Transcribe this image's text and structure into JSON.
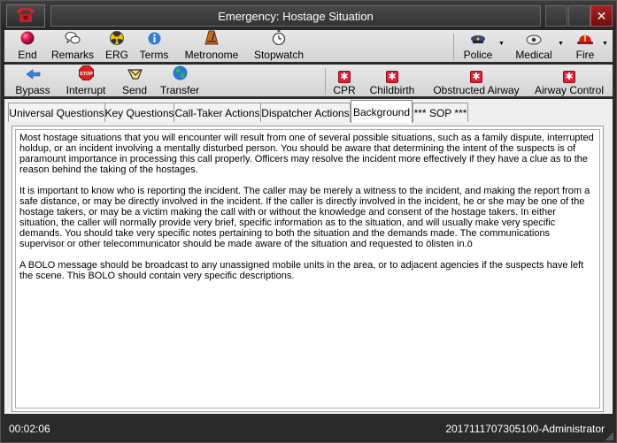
{
  "window": {
    "title": "Emergency: Hostage Situation"
  },
  "toolbar1": {
    "end": "End",
    "remarks": "Remarks",
    "erg": "ERG",
    "terms": "Terms",
    "metronome": "Metronome",
    "stopwatch": "Stopwatch",
    "police": "Police",
    "medical": "Medical",
    "fire": "Fire"
  },
  "toolbar2": {
    "bypass": "Bypass",
    "interrupt": "Interrupt",
    "send": "Send",
    "transfer": "Transfer",
    "cpr": "CPR",
    "childbirth": "Childbirth",
    "obstructed_airway": "Obstructed Airway",
    "airway_control": "Airway Control",
    "stop_sign_text": "STOP"
  },
  "tabs": [
    "Universal Questions",
    "Key Questions",
    "Call-Taker Actions",
    "Dispatcher Actions",
    "Background",
    "*** SOP ***"
  ],
  "active_tab": "Background",
  "content": {
    "paragraphs": [
      "Most hostage situations that you will encounter will result from one of several possible situations, such as a family dispute, interrupted holdup, or an incident involving a mentally disturbed person.  You should be aware that determining the intent of the suspects is of paramount importance in processing this call properly.  Officers may resolve the incident more effectively if they have a clue as to the reason behind the taking of the hostages.",
      "It is important to know who is reporting the incident.  The caller may be merely a witness to the incident, and making the report from a safe distance, or may be directly involved in the incident.  If the caller is directly involved in the incident, he or she may be one of the hostage takers, or may be a victim making the call with or without the knowledge and consent of the hostage takers.  In either situation, the caller will normally provide very brief, specific information as to the situation, and will usually make very specific demands.  You should take very specific notes pertaining to both the situation and the demands made.  The communications supervisor or other telecommunicator should be made aware of the situation and requested to ölisten in.ö",
      "A BOLO message should be broadcast to any unassigned mobile units in the area, or to adjacent agencies if the suspects have left the scene.  This BOLO should contain very specific descriptions."
    ]
  },
  "status": {
    "timer": "00:02:06",
    "session": "2017111707305100-Administrator"
  },
  "icons": {
    "phone": "phone-icon",
    "end": "red-ball-icon",
    "remarks": "speech-bubbles-icon",
    "erg": "hazard-icon",
    "terms": "info-icon",
    "metronome": "metronome-icon",
    "stopwatch": "stopwatch-icon",
    "police": "police-hat-icon",
    "medical": "medical-icon",
    "fire": "fire-helmet-icon",
    "bypass": "bypass-arrow-icon",
    "interrupt": "stop-sign-icon",
    "send": "send-icon",
    "transfer": "globe-icon",
    "protocol": "red-cross-square-icon"
  },
  "colors": {
    "titlebar": "#2a2a2a",
    "toolbar": "#dcdcdc",
    "close_button": "#8b1a1a",
    "protocol_red": "#dd2233"
  }
}
